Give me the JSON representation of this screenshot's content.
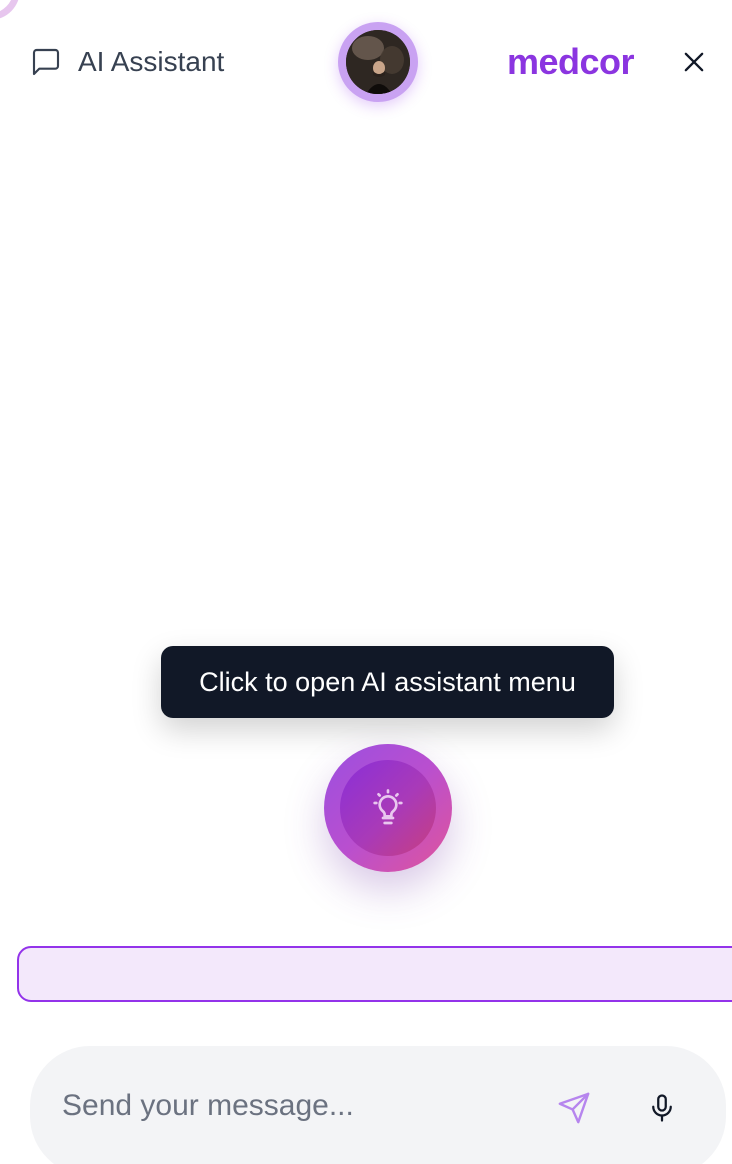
{
  "header": {
    "title": "AI Assistant",
    "brand": "medcor",
    "icons": {
      "chat": "chat-bubble-icon",
      "close": "close-icon"
    }
  },
  "tooltip": {
    "text": "Click to open AI assistant menu"
  },
  "fab": {
    "icon": "lightbulb-icon"
  },
  "composer": {
    "placeholder": "Send your message...",
    "value": "",
    "send_icon": "send-icon",
    "mic_icon": "microphone-icon"
  },
  "colors": {
    "brand": "#8b35e0",
    "tooltip_bg": "#111827",
    "suggestion_border": "#9333ea",
    "suggestion_bg": "#f3e8fb",
    "composer_bg": "#f3f4f6"
  }
}
